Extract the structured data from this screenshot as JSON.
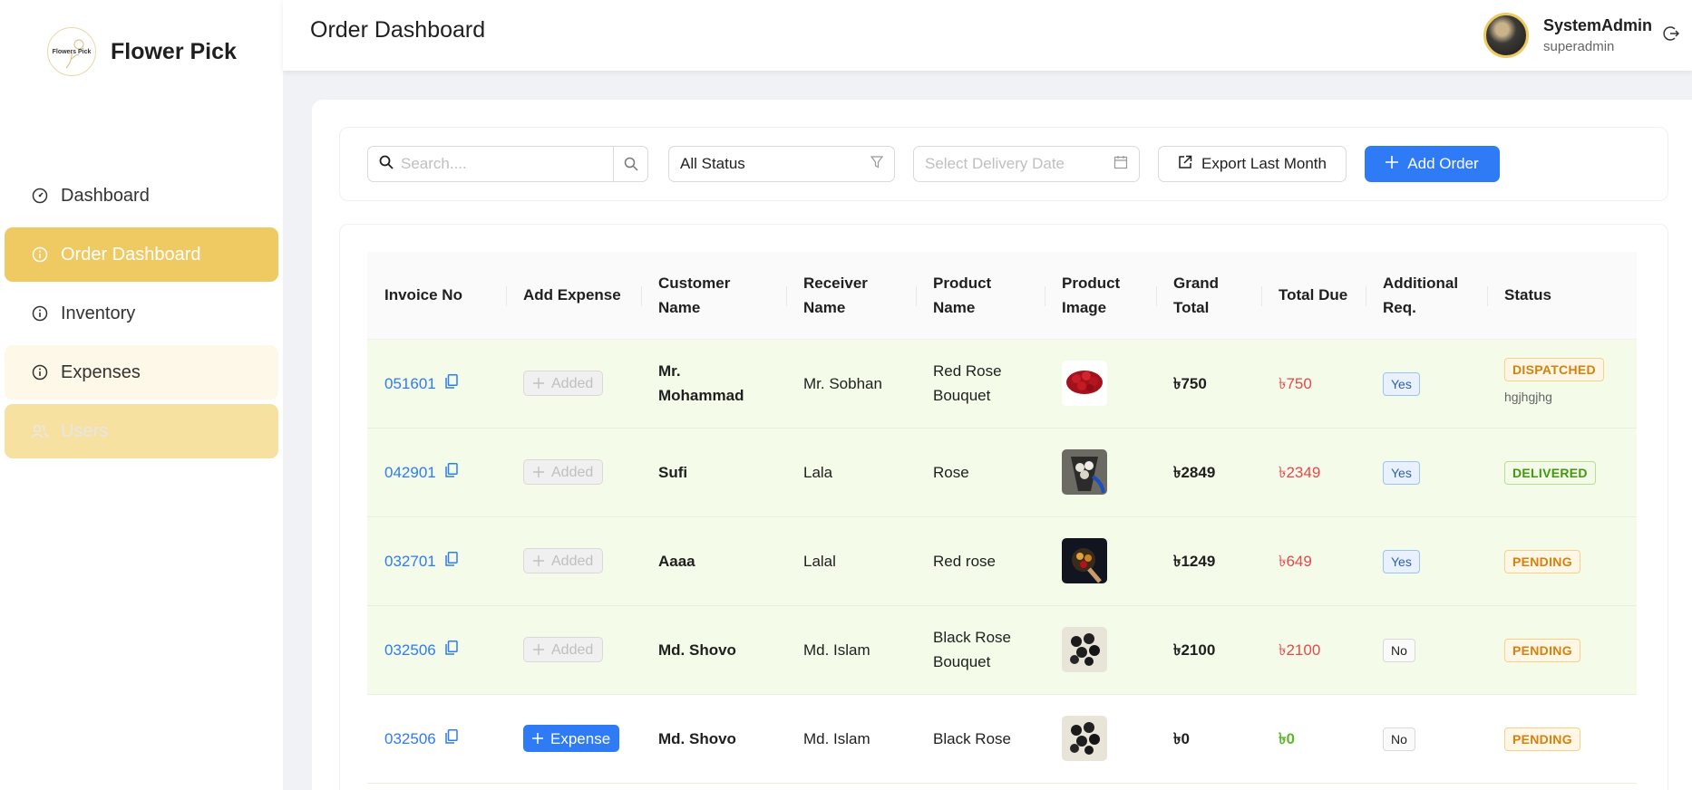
{
  "brand": {
    "logo_text": "Flowers Pick",
    "name": "Flower Pick"
  },
  "sidebar": {
    "items": [
      {
        "label": "Dashboard",
        "icon": "dashboard-icon",
        "state": "normal"
      },
      {
        "label": "Order Dashboard",
        "icon": "info-icon",
        "state": "active"
      },
      {
        "label": "Inventory",
        "icon": "info-icon",
        "state": "normal"
      },
      {
        "label": "Expenses",
        "icon": "info-icon",
        "state": "light"
      },
      {
        "label": "Users",
        "icon": "users-icon",
        "state": "disabled"
      }
    ]
  },
  "header": {
    "title": "Order Dashboard",
    "user_name": "SystemAdmin",
    "user_role": "superadmin"
  },
  "filters": {
    "search_placeholder": "Search....",
    "status_value": "All Status",
    "date_placeholder": "Select Delivery Date",
    "export_label": "Export Last Month",
    "add_label": "Add Order"
  },
  "table": {
    "columns": [
      "Invoice No",
      "Add Expense",
      "Customer Name",
      "Receiver Name",
      "Product Name",
      "Product Image",
      "Grand Total",
      "Total Due",
      "Additional Req.",
      "Status"
    ],
    "rows": [
      {
        "invoice": "051601",
        "expense": "Added",
        "customer": "Mr. Mohammad",
        "receiver": "Mr. Sobhan",
        "product": "Red Rose Bouquet",
        "image": "red-roses",
        "grand_total": "৳750",
        "total_due": "৳750",
        "additional": "Yes",
        "status": "DISPATCHED",
        "status_note": "hgjhgjhg"
      },
      {
        "invoice": "042901",
        "expense": "Added",
        "customer": "Sufi",
        "receiver": "Lala",
        "product": "Rose",
        "image": "bouquet-wrapped",
        "grand_total": "৳2849",
        "total_due": "৳2349",
        "additional": "Yes",
        "status": "DELIVERED",
        "status_note": ""
      },
      {
        "invoice": "032701",
        "expense": "Added",
        "customer": "Aaaa",
        "receiver": "Lalal",
        "product": "Red rose",
        "image": "bouquet-dark",
        "grand_total": "৳1249",
        "total_due": "৳649",
        "additional": "Yes",
        "status": "PENDING",
        "status_note": ""
      },
      {
        "invoice": "032506",
        "expense": "Added",
        "customer": "Md. Shovo",
        "receiver": "Md. Islam",
        "product": "Black Rose Bouquet",
        "image": "black-roses",
        "grand_total": "৳2100",
        "total_due": "৳2100",
        "additional": "No",
        "status": "PENDING",
        "status_note": ""
      },
      {
        "invoice": "032506",
        "expense": "Expense",
        "customer": "Md. Shovo",
        "receiver": "Md. Islam",
        "product": "Black Rose",
        "image": "black-roses",
        "grand_total": "৳0",
        "total_due": "৳0",
        "additional": "No",
        "status": "PENDING",
        "status_note": ""
      }
    ]
  },
  "colors": {
    "accent": "#efc961",
    "primary": "#2f7bf5",
    "row_bg": "#f4fbe9",
    "due_red": "#e5484d",
    "due_green": "#5cb82a"
  }
}
